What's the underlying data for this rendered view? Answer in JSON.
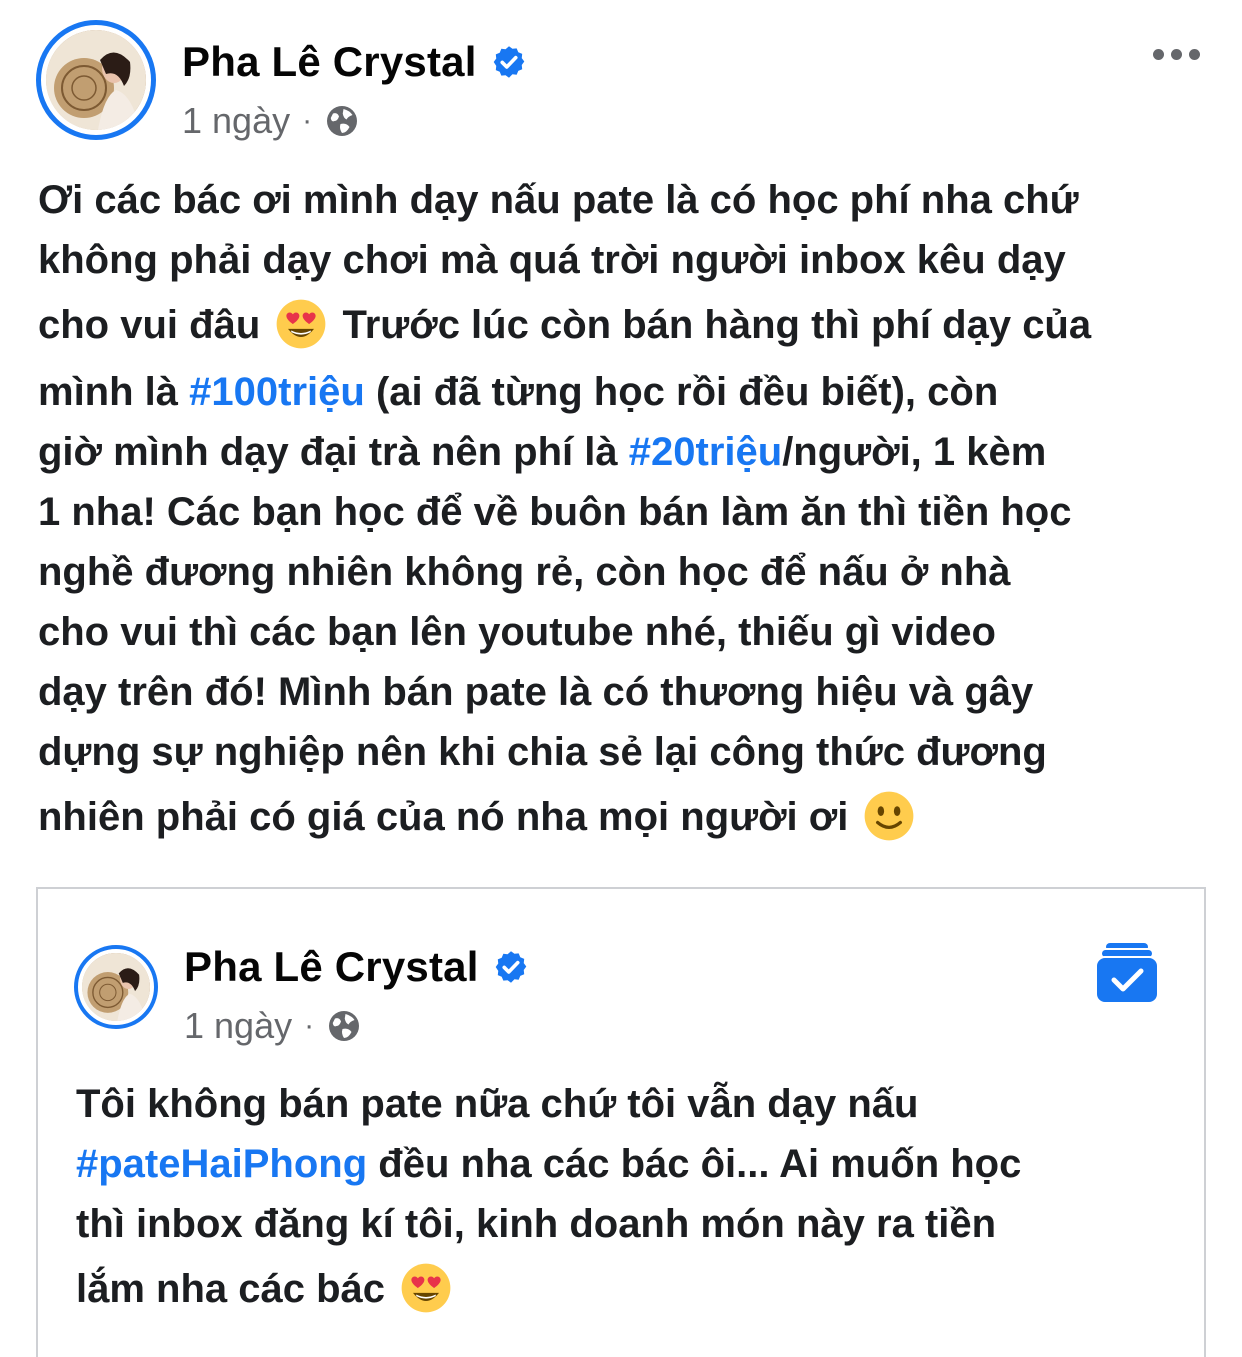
{
  "post": {
    "author": "Pha Lê Crystal",
    "timestamp": "1 ngày",
    "separator": "·",
    "privacy_icon": "globe-icon",
    "verified_icon": "verified-badge-icon",
    "more_icon": "more-options-icon",
    "text": {
      "line1": "Ơi các bác ơi mình dạy nấu pate là có học phí nha chứ",
      "line2": "không phải dạy chơi mà quá trời người inbox kêu dạy",
      "line3a": "cho vui đâu",
      "emoji1": "heart-eyes-emoji",
      "line3b": "Trước lúc còn bán hàng thì phí dạy của",
      "line4a": "mình là",
      "hashtag1": "#100triệu",
      "line4b": "(ai đã từng học rồi đều biết), còn",
      "line5a": "giờ mình dạy đại trà nên phí là",
      "hashtag2": "#20triệu",
      "line5b": "/người, 1 kèm",
      "line6": "1 nha! Các bạn học để về buôn bán làm ăn thì tiền học",
      "line7": "nghề đương nhiên không rẻ, còn học để nấu ở nhà",
      "line8": "cho vui thì các bạn lên youtube nhé, thiếu gì video",
      "line9": "dạy trên đó! Mình bán pate là có thương hiệu và gây",
      "line10": "dựng sự nghiệp nên khi chia sẻ lại công thức đương",
      "line11": "nhiên phải có giá của nó nha mọi người ơi",
      "emoji2": "slightly-smiling-emoji"
    }
  },
  "shared_post": {
    "author": "Pha Lê Crystal",
    "timestamp": "1 ngày",
    "separator": "·",
    "privacy_icon": "globe-icon",
    "saved_icon": "saved-collection-icon",
    "text": {
      "line1": "Tôi không bán pate nữa chứ tôi vẫn dạy nấu",
      "hashtag": "#pateHaiPhong",
      "line2b": "đều nha các bác ôi... Ai muốn học",
      "line3": "thì inbox đăng kí tôi, kinh doanh món này ra tiền",
      "line4": "lắm nha các bác",
      "emoji": "heart-eyes-emoji"
    }
  },
  "colors": {
    "accent": "#1877f2",
    "text": "#1c1e21",
    "secondary_text": "#65676b",
    "border": "#ced0d4"
  }
}
